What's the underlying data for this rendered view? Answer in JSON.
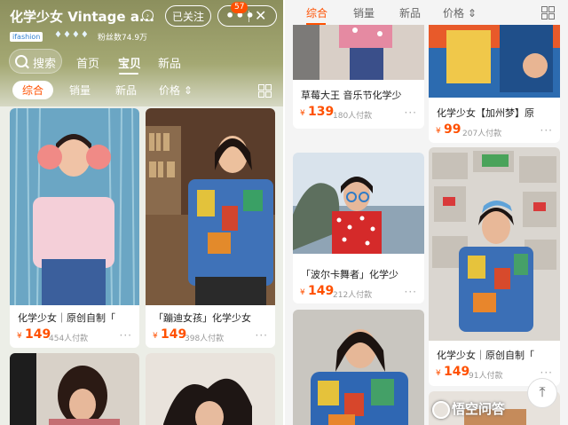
{
  "left": {
    "header": {
      "store_title": "化学少女 Vintage a...",
      "follow_label": "已关注",
      "more_badge": "57",
      "close_icon": "✕",
      "brand_tag": "ifashion",
      "fans": "粉丝数74.9万"
    },
    "nav": {
      "search_label": "搜索",
      "tabs": [
        "首页",
        "宝贝",
        "新品"
      ],
      "active_tab": "宝贝"
    },
    "sort": [
      "综合",
      "销量",
      "新品",
      "价格 ⇕"
    ],
    "cards": [
      {
        "name": "化学少女｜原创自制「",
        "price_symbol": "¥",
        "price": "149",
        "paid": "454人付款"
      },
      {
        "name": "「蹦迪女孩」化学少女",
        "price_symbol": "¥",
        "price": "149",
        "paid": "398人付款"
      }
    ]
  },
  "right": {
    "sort": [
      "综合",
      "销量",
      "新品",
      "价格 ⇕"
    ],
    "cards": [
      {
        "name": "草莓大王 音乐节化学少",
        "price_symbol": "¥",
        "price": "139",
        "paid": "180人付款"
      },
      {
        "name": "化学少女【加州梦】原",
        "price_symbol": "¥",
        "price": "99",
        "paid": "207人付款"
      },
      {
        "name": "「波尔卡舞者」化学少",
        "price_symbol": "¥",
        "price": "149",
        "paid": "212人付款"
      },
      {
        "name": "化学少女｜原创自制「",
        "price_symbol": "¥",
        "price": "149",
        "paid": "91人付款"
      }
    ],
    "watermark": "悟空问答"
  },
  "colors": {
    "accent": "#ff5000",
    "header_olive": "#9a9e6a"
  }
}
